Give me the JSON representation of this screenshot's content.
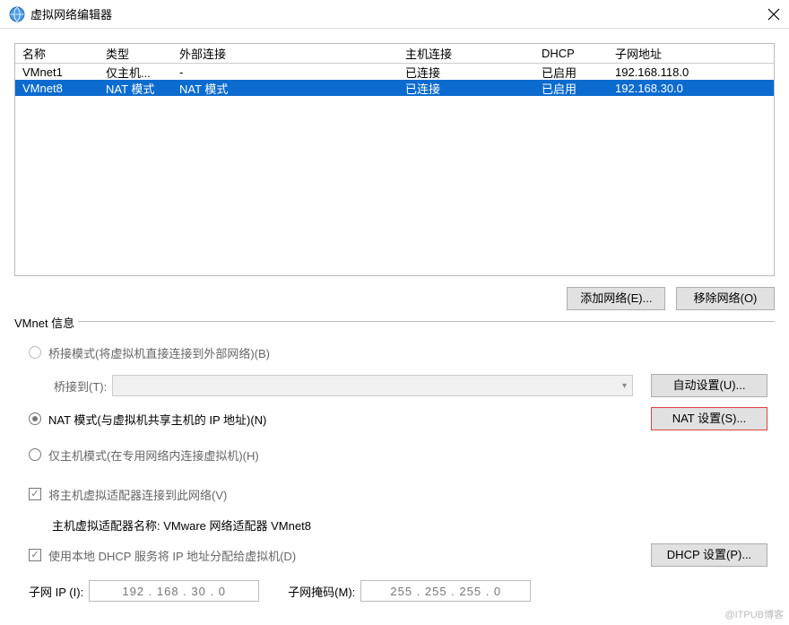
{
  "window": {
    "title": "虚拟网络编辑器"
  },
  "table": {
    "headers": {
      "name": "名称",
      "type": "类型",
      "ext": "外部连接",
      "host": "主机连接",
      "dhcp": "DHCP",
      "subnet": "子网地址"
    },
    "rows": [
      {
        "name": "VMnet1",
        "type": "仅主机...",
        "ext": "-",
        "host": "已连接",
        "dhcp": "已启用",
        "subnet": "192.168.118.0",
        "selected": false
      },
      {
        "name": "VMnet8",
        "type": "NAT 模式",
        "ext": "NAT 模式",
        "host": "已连接",
        "dhcp": "已启用",
        "subnet": "192.168.30.0",
        "selected": true
      }
    ]
  },
  "buttons": {
    "add_network": "添加网络(E)...",
    "remove_network": "移除网络(O)"
  },
  "info": {
    "legend": "VMnet 信息",
    "bridge": {
      "radio": "桥接模式(将虚拟机直接连接到外部网络)(B)",
      "label": "桥接到(T):",
      "auto": "自动设置(U)..."
    },
    "nat": {
      "radio": "NAT 模式(与虚拟机共享主机的 IP 地址)(N)",
      "settings": "NAT 设置(S)..."
    },
    "hostonly": {
      "radio": "仅主机模式(在专用网络内连接虚拟机)(H)"
    },
    "hostadapter": {
      "check": "将主机虚拟适配器连接到此网络(V)",
      "name_label": "主机虚拟适配器名称: VMware 网络适配器 VMnet8"
    },
    "dhcp": {
      "check": "使用本地 DHCP 服务将 IP 地址分配给虚拟机(D)",
      "settings": "DHCP 设置(P)..."
    },
    "subnet_ip_label": "子网 IP (I):",
    "subnet_ip": "192 . 168 . 30 . 0",
    "subnet_mask_label": "子网掩码(M):",
    "subnet_mask": "255 . 255 . 255 . 0"
  },
  "watermark": "@ITPUB博客"
}
